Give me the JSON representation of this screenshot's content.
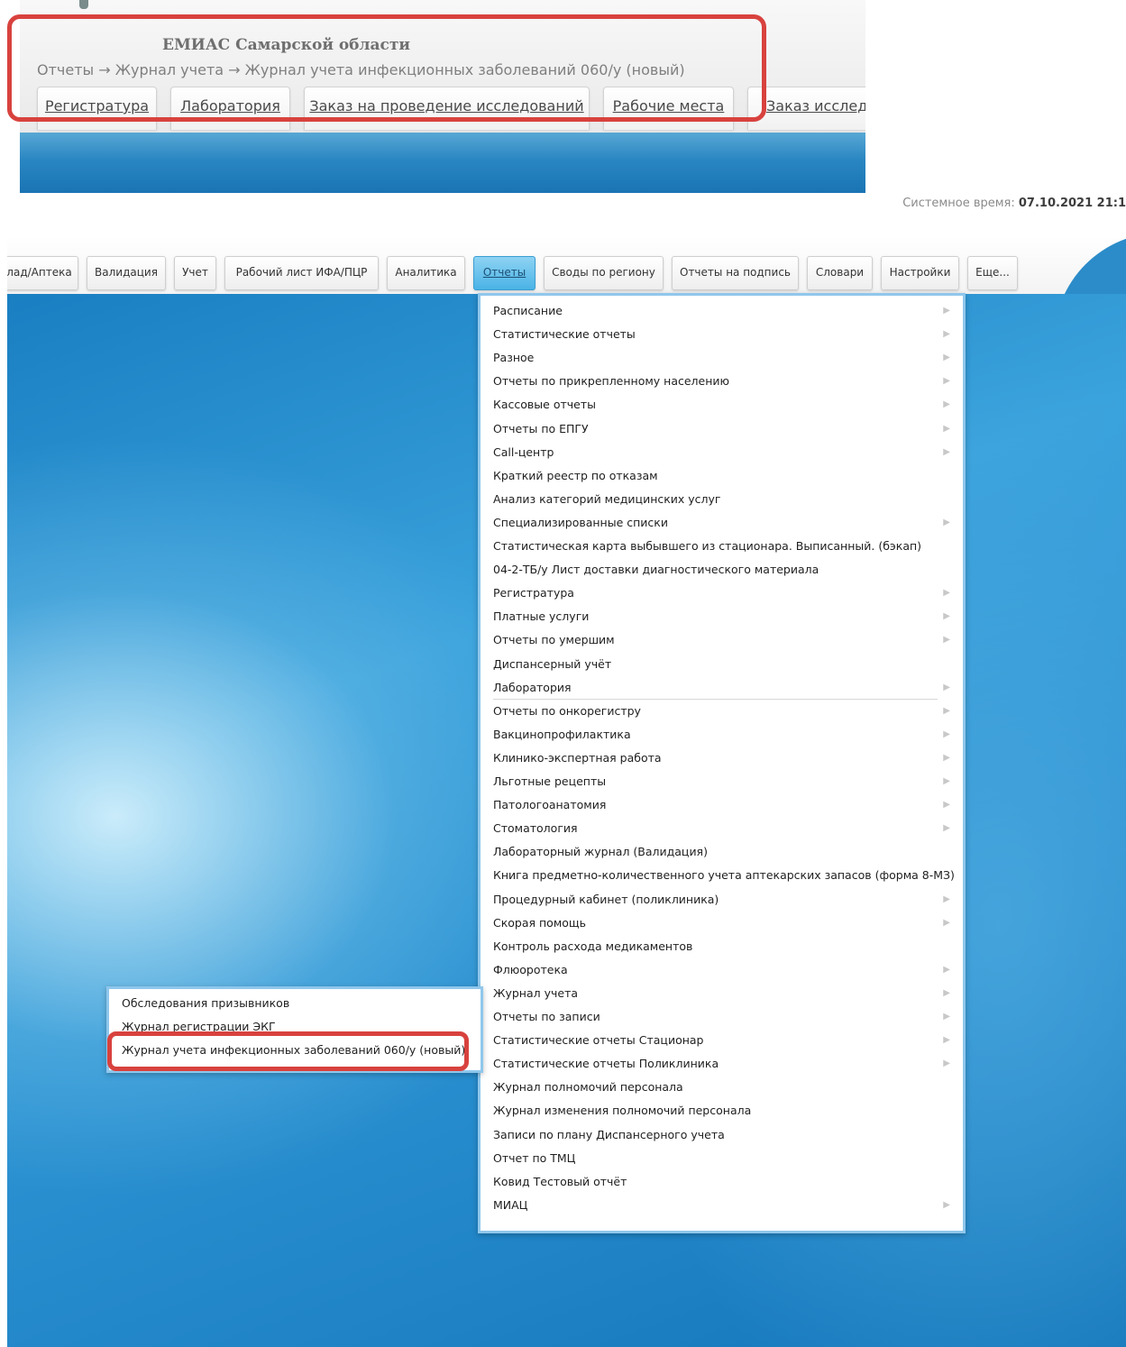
{
  "top": {
    "app_title": "ЕМИАС Самарской области",
    "breadcrumb": "Отчеты → Журнал учета → Журнал учета инфекционных заболеваний 060/у (новый)",
    "tabs": [
      "Регистратура",
      "Лаборатория",
      "Заказ на проведение исследований",
      "Рабочие места",
      "Заказ исследо"
    ]
  },
  "system_time": {
    "label": "Системное время:",
    "value": "07.10.2021 21:1"
  },
  "nav": {
    "tabs": [
      "лад/Аптека",
      "Валидация",
      "Учет",
      "Рабочий лист ИФА/ПЦР",
      "Аналитика",
      "Отчеты",
      "Своды по региону",
      "Отчеты на подпись",
      "Словари",
      "Настройки",
      "Еще..."
    ],
    "active": "Отчеты"
  },
  "reports_menu": {
    "items": [
      {
        "label": "Расписание",
        "submenu": true
      },
      {
        "label": "Статистические отчеты",
        "submenu": true
      },
      {
        "label": "Разное",
        "submenu": true
      },
      {
        "label": "Отчеты по прикрепленному населению",
        "submenu": true
      },
      {
        "label": "Кассовые отчеты",
        "submenu": true
      },
      {
        "label": "Отчеты по ЕПГУ",
        "submenu": true
      },
      {
        "label": "Call-центр",
        "submenu": true
      },
      {
        "label": "Краткий реестр по отказам",
        "submenu": false
      },
      {
        "label": "Анализ категорий медицинских услуг",
        "submenu": false
      },
      {
        "label": "Специализированные списки",
        "submenu": true
      },
      {
        "label": "Статистическая карта выбывшего из стационара. Выписанный. (бэкап)",
        "submenu": false
      },
      {
        "label": "04-2-ТБ/у Лист доставки диагностического материала",
        "submenu": false
      },
      {
        "label": "Регистратура",
        "submenu": true
      },
      {
        "label": "Платные услуги",
        "submenu": true
      },
      {
        "label": "Отчеты по умершим",
        "submenu": true
      },
      {
        "label": "Диспансерный учёт",
        "submenu": false
      },
      {
        "label": "Лаборатория",
        "submenu": true
      },
      {
        "label": "Отчеты по онкорегистру",
        "submenu": true
      },
      {
        "label": "Вакцинопрофилактика",
        "submenu": true
      },
      {
        "label": "Клинико-экспертная работа",
        "submenu": true
      },
      {
        "label": "Льготные рецепты",
        "submenu": true
      },
      {
        "label": "Патологоанатомия",
        "submenu": true
      },
      {
        "label": "Стоматология",
        "submenu": true
      },
      {
        "label": "Лабораторный журнал (Валидация)",
        "submenu": false
      },
      {
        "label": "Книга предметно-количественного учета аптекарских запасов (форма 8-МЗ)",
        "submenu": false
      },
      {
        "label": "Процедурный кабинет (поликлиника)",
        "submenu": true
      },
      {
        "label": "Скорая помощь",
        "submenu": true
      },
      {
        "label": "Контроль расхода медикаментов",
        "submenu": false
      },
      {
        "label": "Флюоротека",
        "submenu": true
      },
      {
        "label": "Журнал учета",
        "submenu": true
      },
      {
        "label": "Отчеты по записи",
        "submenu": true
      },
      {
        "label": "Статистические отчеты Стационар",
        "submenu": true
      },
      {
        "label": "Статистические отчеты Поликлиника",
        "submenu": true
      },
      {
        "label": "Журнал полномочий персонала",
        "submenu": false
      },
      {
        "label": "Журнал изменения полномочий персонала",
        "submenu": false
      },
      {
        "label": "Записи по плану Диспансерного учета",
        "submenu": false
      },
      {
        "label": "Отчет по ТМЦ",
        "submenu": false
      },
      {
        "label": "Ковид Тестовый отчёт",
        "submenu": false
      },
      {
        "label": "МИАЦ",
        "submenu": true
      }
    ]
  },
  "journal_submenu": {
    "items": [
      "Обследования призывников",
      "Журнал регистрации ЭКГ",
      "Журнал учета инфекционных заболеваний 060/у (новый)"
    ]
  },
  "colors": {
    "highlight_frame": "#d8423e",
    "active_tab": "#49b3e6",
    "desktop_blue": "#2a90d0"
  }
}
